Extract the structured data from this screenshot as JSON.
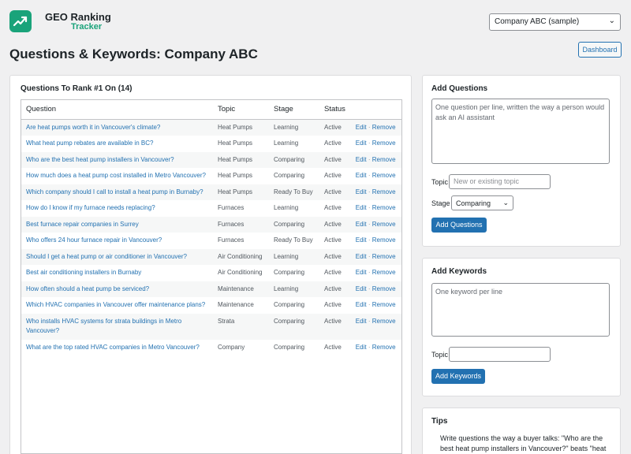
{
  "brand": {
    "line1": "GEO Ranking",
    "line2": "Tracker"
  },
  "company_select": {
    "value": "Company ABC (sample)"
  },
  "page_title": "Questions & Keywords: Company ABC",
  "dashboard_button": "Dashboard",
  "questions_card": {
    "title": "Questions To Rank #1 On (14)",
    "columns": [
      "Question",
      "Topic",
      "Stage",
      "Status"
    ],
    "edit_label": "Edit",
    "remove_label": "Remove",
    "separator": "·",
    "rows": [
      {
        "question": "Are heat pumps worth it in Vancouver's climate?",
        "topic": "Heat Pumps",
        "stage": "Learning",
        "status": "Active"
      },
      {
        "question": "What heat pump rebates are available in BC?",
        "topic": "Heat Pumps",
        "stage": "Learning",
        "status": "Active"
      },
      {
        "question": "Who are the best heat pump installers in Vancouver?",
        "topic": "Heat Pumps",
        "stage": "Comparing",
        "status": "Active"
      },
      {
        "question": "How much does a heat pump cost installed in Metro Vancouver?",
        "topic": "Heat Pumps",
        "stage": "Comparing",
        "status": "Active"
      },
      {
        "question": "Which company should I call to install a heat pump in Burnaby?",
        "topic": "Heat Pumps",
        "stage": "Ready To Buy",
        "status": "Active"
      },
      {
        "question": "How do I know if my furnace needs replacing?",
        "topic": "Furnaces",
        "stage": "Learning",
        "status": "Active"
      },
      {
        "question": "Best furnace repair companies in Surrey",
        "topic": "Furnaces",
        "stage": "Comparing",
        "status": "Active"
      },
      {
        "question": "Who offers 24 hour furnace repair in Vancouver?",
        "topic": "Furnaces",
        "stage": "Ready To Buy",
        "status": "Active"
      },
      {
        "question": "Should I get a heat pump or air conditioner in Vancouver?",
        "topic": "Air Conditioning",
        "stage": "Learning",
        "status": "Active"
      },
      {
        "question": "Best air conditioning installers in Burnaby",
        "topic": "Air Conditioning",
        "stage": "Comparing",
        "status": "Active"
      },
      {
        "question": "How often should a heat pump be serviced?",
        "topic": "Maintenance",
        "stage": "Learning",
        "status": "Active"
      },
      {
        "question": "Which HVAC companies in Vancouver offer maintenance plans?",
        "topic": "Maintenance",
        "stage": "Comparing",
        "status": "Active"
      },
      {
        "question": "Who installs HVAC systems for strata buildings in Metro Vancouver?",
        "topic": "Strata",
        "stage": "Comparing",
        "status": "Active"
      },
      {
        "question": "What are the top rated HVAC companies in Metro Vancouver?",
        "topic": "Company",
        "stage": "Comparing",
        "status": "Active"
      }
    ]
  },
  "add_questions": {
    "title": "Add Questions",
    "textarea_placeholder": "One question per line, written the way a person would ask an AI assistant",
    "topic_label": "Topic",
    "topic_placeholder": "New or existing topic",
    "stage_label": "Stage",
    "stage_value": "Comparing",
    "button": "Add Questions"
  },
  "add_keywords": {
    "title": "Add Keywords",
    "textarea_placeholder": "One keyword per line",
    "topic_label": "Topic",
    "button": "Add Keywords"
  },
  "tips": {
    "title": "Tips",
    "text": "Write questions the way a buyer talks: \"Who are the best heat pump installers in Vancouver?\" beats \"heat pump installers\"."
  }
}
